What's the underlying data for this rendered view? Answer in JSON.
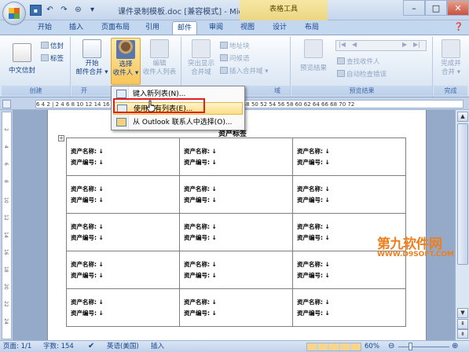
{
  "titlebar": {
    "doc_title": "课件录制模板.doc [兼容模式] - Microsoft ...",
    "context_tab": "表格工具"
  },
  "tabs": [
    "开始",
    "插入",
    "页面布局",
    "引用",
    "邮件",
    "审阅",
    "视图",
    "设计",
    "布局"
  ],
  "active_tab": "邮件",
  "ribbon": {
    "create": {
      "label": "创建",
      "chinese_envelope": "中文信封",
      "envelope": "信封",
      "labels": "标签"
    },
    "start_merge": {
      "label": "开",
      "start": "开始",
      "mail_merge": "邮件合并 ▾",
      "select": "选择",
      "recipients": "收件人 ▾",
      "edit": "编辑",
      "edit_list": "收件人列表"
    },
    "fields": {
      "label": "域",
      "highlight": "突出显示",
      "merge_fields": "合并域",
      "address_block": "地址块",
      "greeting": "问候语",
      "insert_field": "插入合并域 ▾"
    },
    "preview": {
      "label": "预览结果",
      "preview_results": "预览结果",
      "find_recipient": "查找收件人",
      "auto_check": "自动检查错误"
    },
    "finish": {
      "label": "完成",
      "finish_merge": "完成并",
      "merge": "合并 ▾"
    }
  },
  "ruler_text": "6  4  2  |  2  4  6  8  10  12  14  16  18  20  22  24  26  28  30  32  34  36  38  40  42  44  46  48  50  52  54  56  58  60  62  64  66  68  70  72",
  "dropdown_menu": {
    "items": [
      "键入新列表(N)...",
      "使用现有列表(E)...",
      "从 Outlook 联系人中选择(O)..."
    ],
    "highlighted_index": 1
  },
  "document": {
    "heading": "资产标签",
    "cell_line1": "资产名称: ↓",
    "cell_line2": "资产编号: ↓"
  },
  "statusbar": {
    "page": "页面: 1/1",
    "words": "字数: 154",
    "language": "英语(美国)",
    "mode": "插入",
    "zoom": "60%"
  },
  "watermark": {
    "main": "第九软件网",
    "sub": "WWW.D9SOFT.COM"
  },
  "colors": {
    "ribbon_bg": "#e3ecf7",
    "accent": "#15428b",
    "highlight_frame": "#e02020",
    "watermark": "#ec7f1f"
  }
}
